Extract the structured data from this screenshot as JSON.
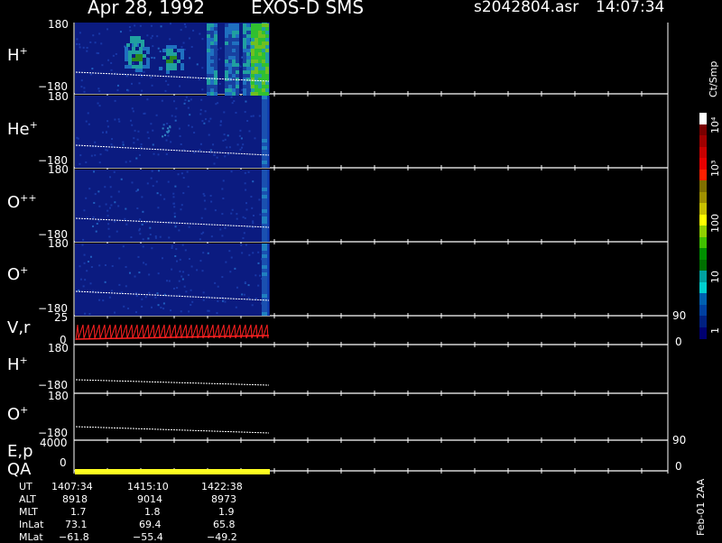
{
  "header": {
    "date": "Apr 28, 1992",
    "instrument": "EXOS-D SMS",
    "file": "s2042804.asr",
    "time": "14:07:34"
  },
  "panels": [
    {
      "label": "H",
      "sup": "+",
      "top": "180",
      "bottom": "−180"
    },
    {
      "label": "He",
      "sup": "+",
      "top": "180",
      "bottom": "−180"
    },
    {
      "label": "O",
      "sup": "++",
      "top": "180",
      "bottom": "−180"
    },
    {
      "label": "O",
      "sup": "+",
      "top": "180",
      "bottom": "−180"
    }
  ],
  "vr_panel": {
    "label": "V,r",
    "left_top": "25",
    "left_bottom": "0",
    "right_top": "90",
    "right_bottom": "0"
  },
  "lower_panels": [
    {
      "label": "H",
      "sup": "+",
      "top": "180",
      "bottom": "−180"
    },
    {
      "label": "O",
      "sup": "+",
      "top": "180",
      "bottom": "−180"
    }
  ],
  "ep_panel": {
    "label1": "E,p",
    "label2": "QA",
    "left_top": "4000",
    "left_bottom": "0",
    "right_top": "90",
    "right_bottom": "0"
  },
  "colorbar": {
    "unit": "Ct/Smp",
    "ticks": [
      "10⁴",
      "10³",
      "100",
      "10",
      "1"
    ],
    "colors": [
      "#ffffff",
      "#7a0000",
      "#a00000",
      "#c80000",
      "#e60000",
      "#ff2000",
      "#807000",
      "#a09000",
      "#c8c000",
      "#ffff00",
      "#90d000",
      "#40c000",
      "#008f00",
      "#006f00",
      "#00a0a0",
      "#00d0d0",
      "#0060b0",
      "#0040a0",
      "#002080",
      "#000070"
    ]
  },
  "ephemeris": {
    "rows": [
      {
        "name": "UT",
        "values": [
          "1407:34",
          "1415:10",
          "1422:38"
        ]
      },
      {
        "name": "ALT",
        "values": [
          "8918",
          "9014",
          "8973"
        ]
      },
      {
        "name": "MLT",
        "values": [
          "1.7",
          "1.8",
          "1.9"
        ]
      },
      {
        "name": "InLat",
        "values": [
          "73.1",
          "69.4",
          "65.8"
        ]
      },
      {
        "name": "MLat",
        "values": [
          "−61.8",
          "−55.4",
          "−49.2"
        ]
      }
    ]
  },
  "footer_vertical": "Feb-01 2AA",
  "chart_data": {
    "type": "heatmap",
    "title": "Apr 28, 1992   EXOS-D SMS",
    "ylim": [
      -180,
      180
    ],
    "series": [
      {
        "name": "H+"
      },
      {
        "name": "He+"
      },
      {
        "name": "O++"
      },
      {
        "name": "O+"
      }
    ],
    "colorbar_scale": "log",
    "colorbar_range": [
      1,
      10000
    ],
    "x_ticks": [
      "1407:34",
      "1415:10",
      "1422:38"
    ]
  }
}
